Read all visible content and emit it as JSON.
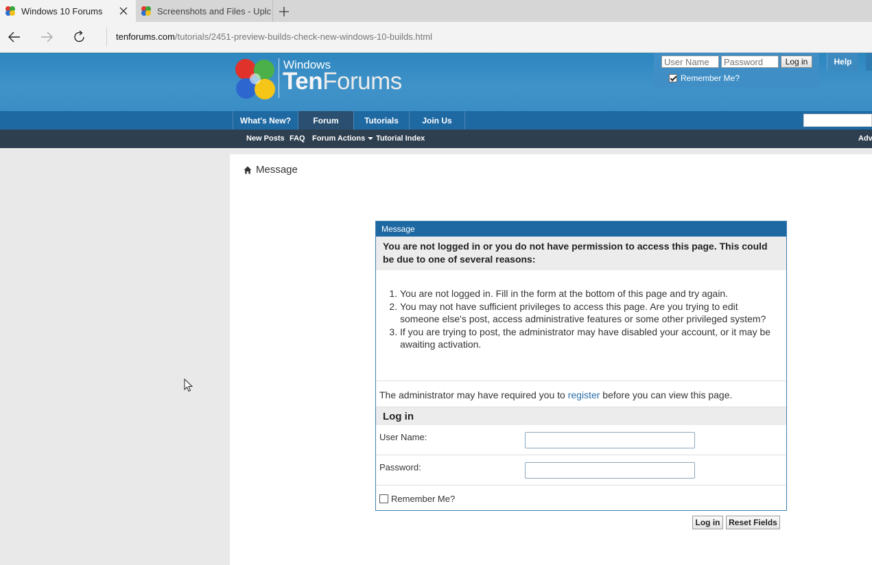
{
  "browser": {
    "tabs": [
      {
        "title": "Windows 10 Forums",
        "active": true
      },
      {
        "title": "Screenshots and Files - Uplc",
        "active": false
      }
    ],
    "url_host": "tenforums.com",
    "url_path": "/tutorials/2451-preview-builds-check-new-windows-10-builds.html"
  },
  "header": {
    "logo_small": "Windows",
    "logo_ten": "Ten",
    "logo_forums": "Forums",
    "username_placeholder": "User Name",
    "password_placeholder": "Password",
    "login_label": "Log in",
    "remember_label": "Remember Me?",
    "help_label": "Help"
  },
  "nav": {
    "tabs": [
      "What's New?",
      "Forum",
      "Tutorials",
      "Join Us"
    ],
    "active": "Forum",
    "sub": [
      "New Posts",
      "FAQ",
      "Forum Actions",
      "Tutorial Index",
      "Adv"
    ]
  },
  "breadcrumb": "Message",
  "message": {
    "title": "Message",
    "warning": "You are not logged in or you do not have permission to access this page. This could be due to one of several reasons:",
    "reasons": [
      "You are not logged in. Fill in the form at the bottom of this page and try again.",
      "You may not have sufficient privileges to access this page. Are you trying to edit someone else's post, access administrative features or some other privileged system?",
      "If you are trying to post, the administrator may have disabled your account, or it may be awaiting activation."
    ],
    "register_before": "The administrator may have required you to ",
    "register_link": "register",
    "register_after": " before you can view this page."
  },
  "login_form": {
    "title": "Log in",
    "username_label": "User Name:",
    "password_label": "Password:",
    "remember_label": "Remember Me?",
    "submit_label": "Log in",
    "reset_label": "Reset Fields"
  },
  "colors": {
    "header_blue": "#3f93c9",
    "nav_blue": "#1f69a3",
    "subnav_dark": "#2e3f4f",
    "link": "#2a6ea8"
  }
}
